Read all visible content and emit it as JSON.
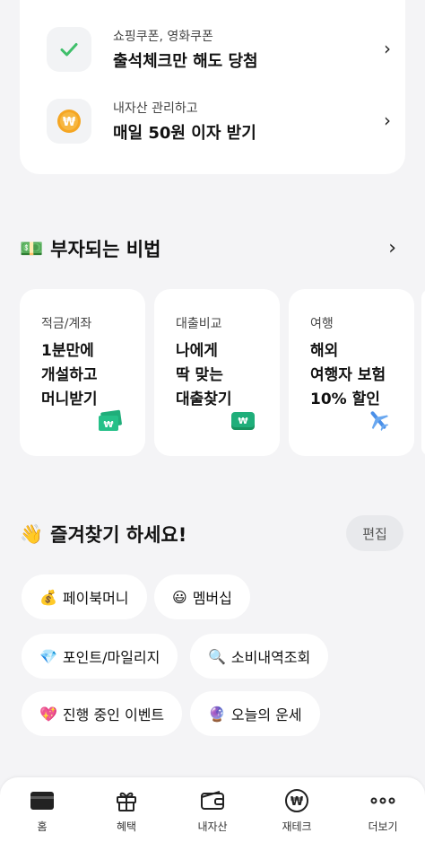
{
  "promos": [
    {
      "subtitle": "쇼핑쿠폰, 영화쿠폰",
      "title": "출석체크만 해도 당첨",
      "icon": "check-icon"
    },
    {
      "subtitle": "내자산 관리하고",
      "title": "매일 50원 이자 받기",
      "icon": "won-coin-icon"
    }
  ],
  "tips_section": {
    "emoji": "💵",
    "title": "부자되는 비법",
    "cards": [
      {
        "category": "적금/계좌",
        "text": "1분만에\n개설하고\n머니받기",
        "icon": "money-bills-icon"
      },
      {
        "category": "대출비교",
        "text": "나에게\n딱 맞는\n대출찾기",
        "icon": "money-stack-icon"
      },
      {
        "category": "여행",
        "text": "해외\n여행자 보험\n10% 할인",
        "icon": "airplane-icon"
      }
    ]
  },
  "favorites_section": {
    "emoji": "👋",
    "title": "즐겨찾기 하세요!",
    "edit_label": "편집",
    "chips": [
      {
        "emoji": "💰",
        "label": "페이북머니"
      },
      {
        "emoji": "😃",
        "label": "멤버십"
      },
      {
        "emoji": "💎",
        "label": "포인트/마일리지"
      },
      {
        "emoji": "🔍",
        "label": "소비내역조회"
      },
      {
        "emoji": "💖",
        "label": "진행 중인 이벤트"
      },
      {
        "emoji": "🔮",
        "label": "오늘의 운세"
      }
    ]
  },
  "tabbar": {
    "tabs": [
      {
        "label": "홈",
        "icon": "card-icon",
        "active": true
      },
      {
        "label": "혜택",
        "icon": "gift-icon"
      },
      {
        "label": "내자산",
        "icon": "wallet-icon"
      },
      {
        "label": "재테크",
        "icon": "won-circle-icon"
      },
      {
        "label": "더보기",
        "icon": "more-dots-icon"
      }
    ]
  },
  "colors": {
    "check_green": "#3fbf6a",
    "coin_orange": "#f5a623",
    "money_green": "#1fae7a",
    "plane_blue": "#4a8fe8"
  }
}
